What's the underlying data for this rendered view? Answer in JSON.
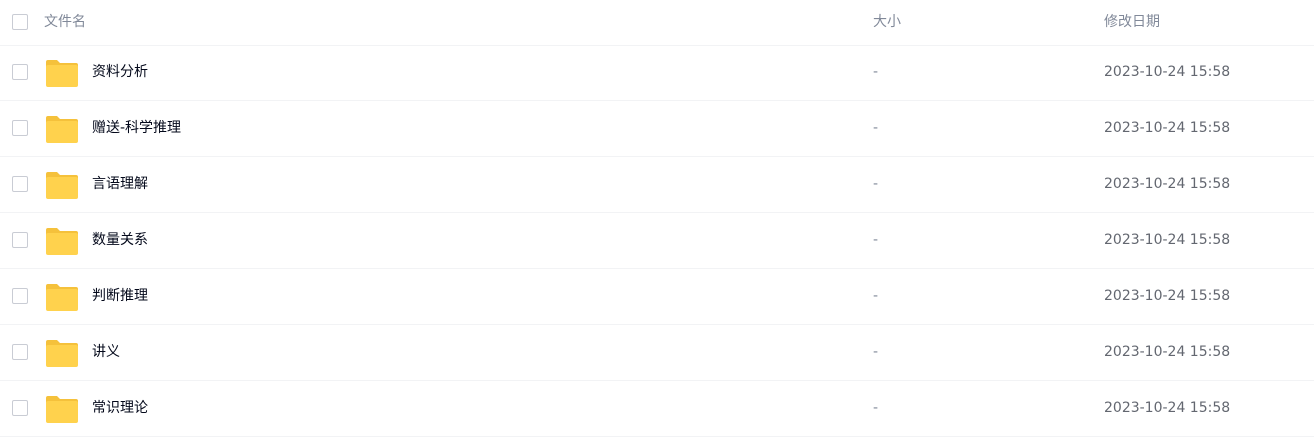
{
  "header": {
    "name_label": "文件名",
    "size_label": "大小",
    "date_label": "修改日期"
  },
  "colors": {
    "folder": "#ffd24d",
    "folder_tab": "#f5c13b",
    "border": "#f2f3f5",
    "muted_text": "#818999"
  },
  "files": [
    {
      "name": "资料分析",
      "size": "-",
      "modified": "2023-10-24 15:58",
      "icon": "folder-icon"
    },
    {
      "name": "赠送-科学推理",
      "size": "-",
      "modified": "2023-10-24 15:58",
      "icon": "folder-icon"
    },
    {
      "name": "言语理解",
      "size": "-",
      "modified": "2023-10-24 15:58",
      "icon": "folder-icon"
    },
    {
      "name": "数量关系",
      "size": "-",
      "modified": "2023-10-24 15:58",
      "icon": "folder-icon"
    },
    {
      "name": "判断推理",
      "size": "-",
      "modified": "2023-10-24 15:58",
      "icon": "folder-icon"
    },
    {
      "name": "讲义",
      "size": "-",
      "modified": "2023-10-24 15:58",
      "icon": "folder-icon"
    },
    {
      "name": "常识理论",
      "size": "-",
      "modified": "2023-10-24 15:58",
      "icon": "folder-icon"
    }
  ]
}
